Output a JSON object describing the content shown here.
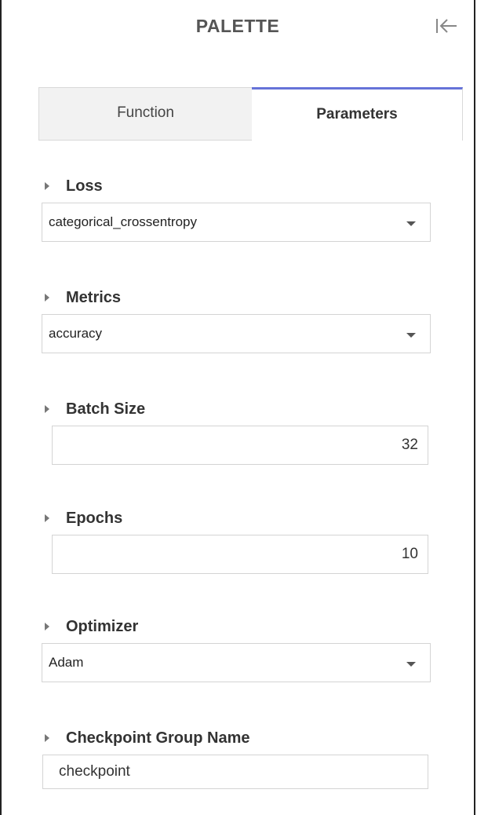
{
  "palette": {
    "title": "PALETTE",
    "collapse_icon": "collapse-left-icon"
  },
  "tabs": [
    {
      "label": "Function",
      "active": false
    },
    {
      "label": "Parameters",
      "active": true
    }
  ],
  "params": {
    "loss": {
      "label": "Loss",
      "value": "categorical_crossentropy"
    },
    "metrics": {
      "label": "Metrics",
      "value": "accuracy"
    },
    "batch_size": {
      "label": "Batch Size",
      "value": "32"
    },
    "epochs": {
      "label": "Epochs",
      "value": "10"
    },
    "optimizer": {
      "label": "Optimizer",
      "value": "Adam"
    },
    "checkpoint": {
      "label": "Checkpoint Group Name",
      "value": "checkpoint"
    }
  },
  "colors": {
    "active_tab_accent": "#6673d8",
    "border": "#d4d4d4"
  }
}
